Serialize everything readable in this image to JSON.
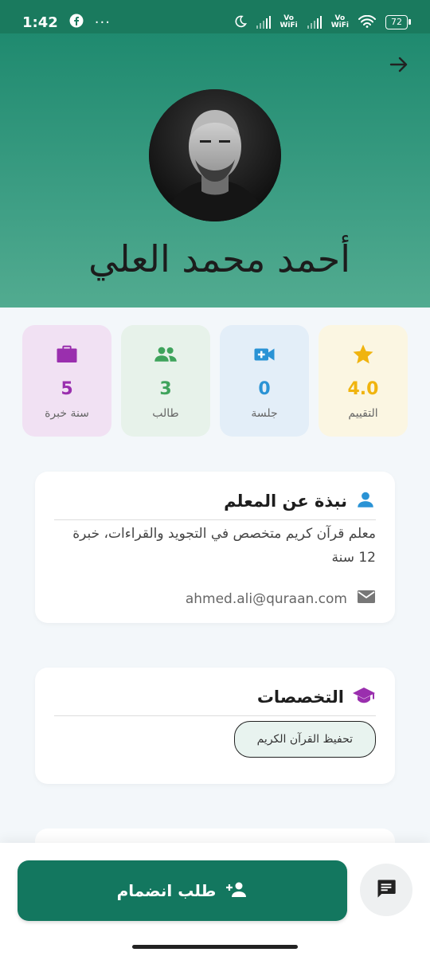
{
  "status_bar": {
    "time": "1:42",
    "vo_label": "Vo",
    "wifi_label": "WiFi",
    "battery": "72"
  },
  "profile": {
    "name": "أحمد محمد العلي"
  },
  "stats": [
    {
      "value": "4.0",
      "label": "التقييم",
      "icon": "star-icon",
      "color": "#f0b40f",
      "bg": "#fbf6e2"
    },
    {
      "value": "0",
      "label": "جلسة",
      "icon": "video-add-icon",
      "color": "#2a93d5",
      "bg": "#e3eef8"
    },
    {
      "value": "3",
      "label": "طالب",
      "icon": "people-icon",
      "color": "#3fa35c",
      "bg": "#e7f2ea"
    },
    {
      "value": "5",
      "label": "سنة خبرة",
      "icon": "briefcase-icon",
      "color": "#9a2fae",
      "bg": "#f1e1f3"
    }
  ],
  "about": {
    "title": "نبذة عن المعلم",
    "bio": "معلم قرآن كريم متخصص في التجويد والقراءات، خبرة 12 سنة",
    "email": "ahmed.ali@quraan.com"
  },
  "specialties": {
    "title": "التخصصات",
    "items": [
      "تحفيظ القرآن الكريم"
    ]
  },
  "actions": {
    "join_label": "طلب انضمام"
  },
  "colors": {
    "primary": "#13775f",
    "header": "#1a7a5e"
  }
}
